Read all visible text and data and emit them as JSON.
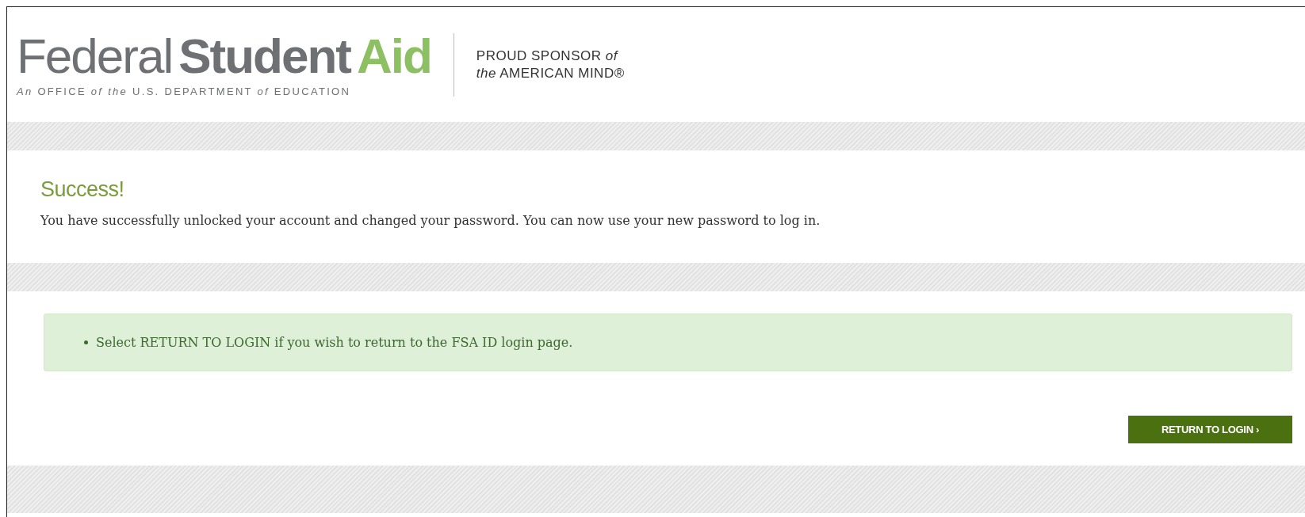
{
  "header": {
    "logo": [
      {
        "kind": "light",
        "text": "Federal"
      },
      {
        "kind": "bold",
        "text": "Student"
      },
      {
        "kind": "accent",
        "text": "Aid"
      }
    ],
    "logo_subtitle": "*An* OFFICE *of the* U.S. DEPARTMENT *of* EDUCATION",
    "sponsor": [
      "PROUD SPONSOR *of*",
      "*the* AMERICAN MIND®"
    ]
  },
  "message": {
    "title": "Success!",
    "body": "You have successfully unlocked your account and changed your password. You can now use your new password to log in."
  },
  "notice": {
    "items": [
      "Select RETURN TO LOGIN if you wish to return to the FSA ID login page."
    ]
  },
  "button": {
    "label": "RETURN TO LOGIN ›"
  }
}
